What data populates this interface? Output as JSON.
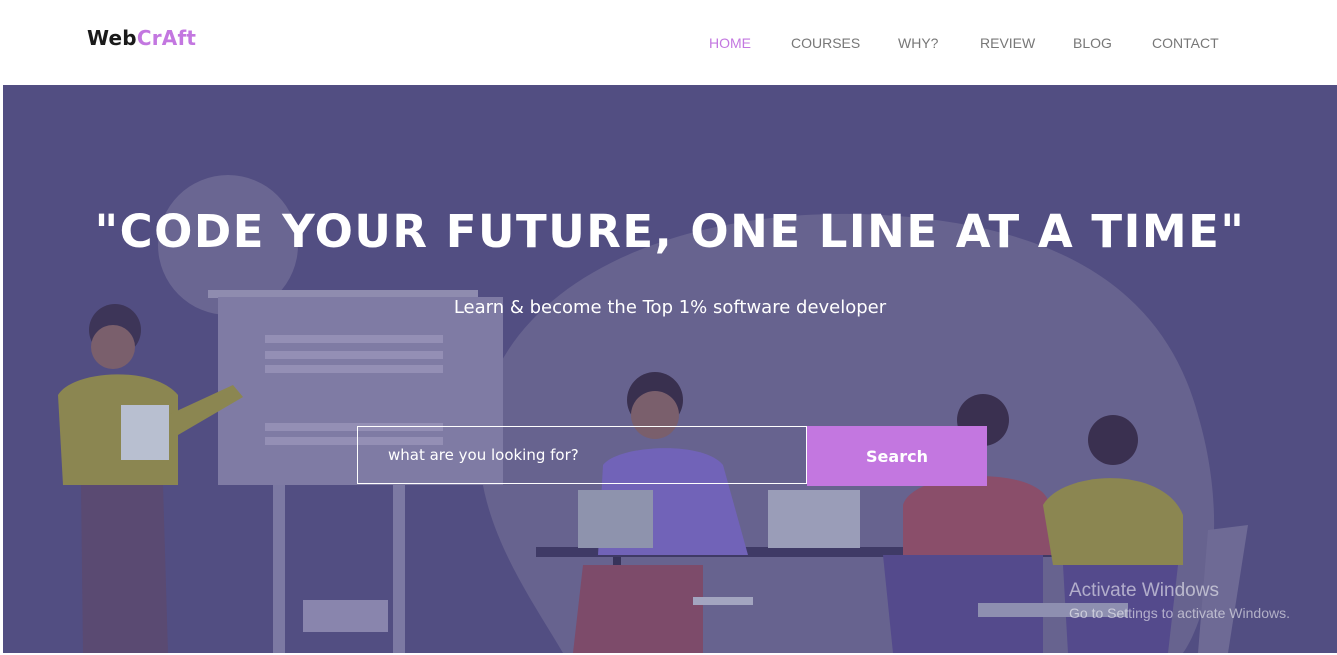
{
  "brand": {
    "prefix": "Web",
    "accent": "CrAft",
    "accent_color": "#c377e0"
  },
  "nav": {
    "items": [
      {
        "label": "HOME",
        "active": true
      },
      {
        "label": "COURSES",
        "active": false
      },
      {
        "label": "WHY?",
        "active": false
      },
      {
        "label": "REVIEW",
        "active": false
      },
      {
        "label": "BLOG",
        "active": false
      },
      {
        "label": "CONTACT",
        "active": false
      }
    ]
  },
  "hero": {
    "headline": "\"CODE YOUR FUTURE, ONE LINE AT A TIME\"",
    "subtitle": "Learn & become the Top 1% software developer",
    "background_color": "#524e82"
  },
  "search": {
    "placeholder": "what are you looking for?",
    "value": "",
    "button_label": "Search"
  },
  "watermark": {
    "title": "Activate Windows",
    "subtitle": "Go to Settings to activate Windows."
  }
}
